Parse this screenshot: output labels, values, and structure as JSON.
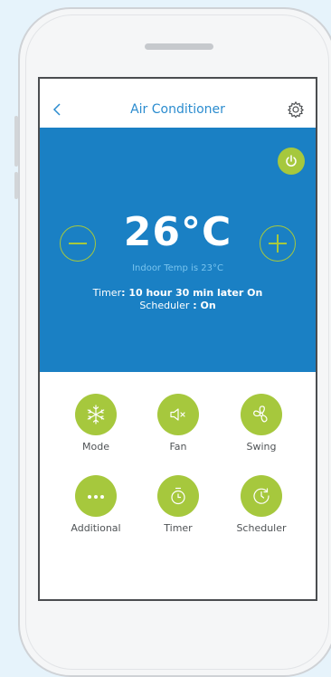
{
  "nav": {
    "back_icon": "chevron-left-icon",
    "title": "Air Conditioner",
    "settings_icon": "gear-icon"
  },
  "hero": {
    "temperature": "26°C",
    "indoor_temp": "Indoor Temp is 23°C",
    "timer_label": "Timer",
    "timer_value": "10 hour 30 min later On",
    "scheduler_label": "Scheduler",
    "scheduler_value": "On",
    "power_icon": "power-icon",
    "minus_icon": "minus-icon",
    "plus_icon": "plus-icon"
  },
  "controls": [
    {
      "label": "Mode",
      "icon": "snowflake-icon"
    },
    {
      "label": "Fan",
      "icon": "speaker-mute-icon"
    },
    {
      "label": "Swing",
      "icon": "fan-icon"
    },
    {
      "label": "Additional",
      "icon": "ellipsis-icon"
    },
    {
      "label": "Timer",
      "icon": "stopwatch-icon"
    },
    {
      "label": "Scheduler",
      "icon": "clock-icon"
    }
  ],
  "colors": {
    "background": "#e6f3fb",
    "accent_blue": "#1a80c4",
    "title_blue": "#2b8ccf",
    "accent_green": "#a6c83d",
    "indoor_text": "#79c4ef",
    "label_gray": "#4f5356"
  }
}
